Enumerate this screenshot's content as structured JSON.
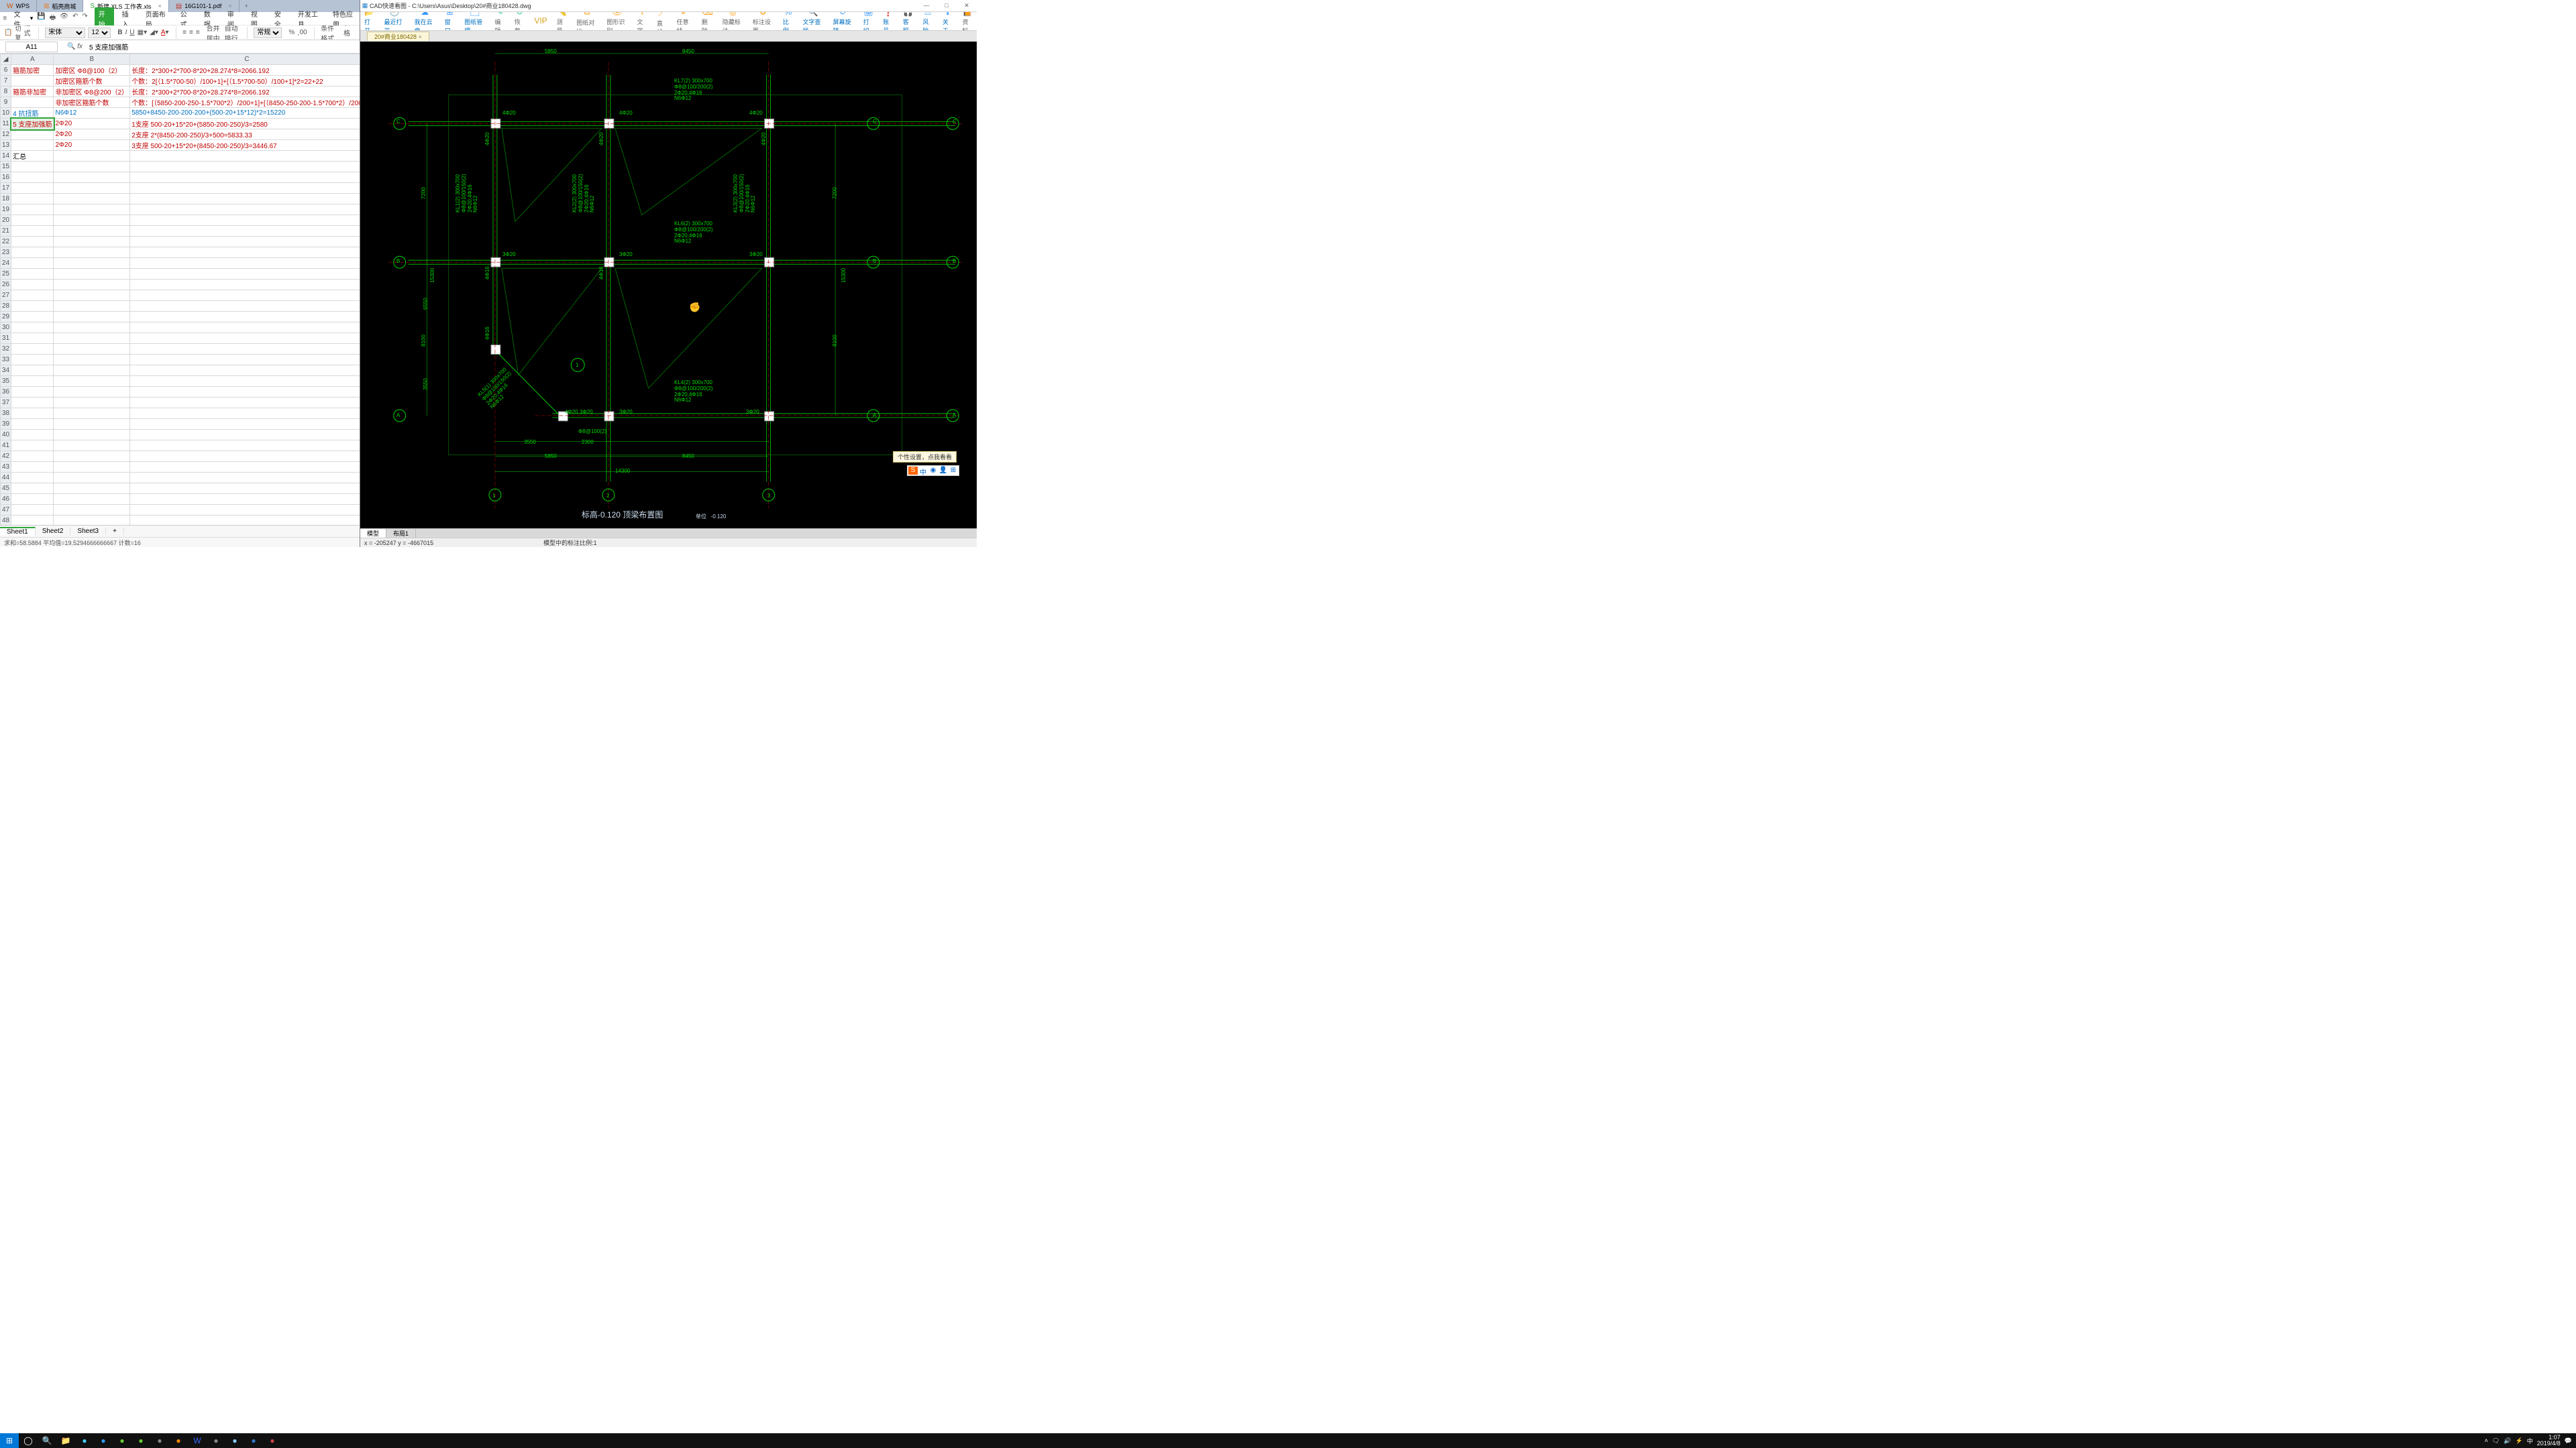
{
  "wps": {
    "tabs": [
      {
        "icon": "W",
        "label": "WPS",
        "iconColor": "#d35400"
      },
      {
        "icon": "⊞",
        "label": "稻壳商城",
        "iconColor": "#e67e22"
      },
      {
        "icon": "S",
        "label": "新建 XLS 工作表.xls",
        "iconColor": "#2fa639",
        "active": true,
        "closeable": true
      },
      {
        "icon": "📄",
        "label": "16G101-1.pdf",
        "iconColor": "#c0392b",
        "closeable": true
      }
    ],
    "menu": {
      "file": "文件",
      "items": [
        "开始",
        "插入",
        "页面布局",
        "公式",
        "数据",
        "审阅",
        "视图",
        "安全",
        "开发工具",
        "特色应用"
      ]
    },
    "toolbar": {
      "cut": "剪切",
      "copy": "复制",
      "paint": "格式刷",
      "font": "宋体",
      "size": "12",
      "style": "常规",
      "merge": "合并居中",
      "wrap": "自动换行",
      "cond": "条件格式",
      "table": "表格样"
    },
    "cell_ref": "A11",
    "fx_val": "5 支座加强筋",
    "cols": [
      "A",
      "B",
      "C"
    ],
    "rows": [
      {
        "n": 6,
        "a": "箍筋加密",
        "b": "加密区   Φ8@100（2）",
        "c": "长度：2*300+2*700-8*20+28.274*8=2066.192",
        "cls": "red"
      },
      {
        "n": 7,
        "a": "",
        "b": "加密区箍筋个数",
        "c": "个数：2[（1.5*700-50）/100+1]+[（1.5*700-50）/100+1]*2=22+22",
        "cls": "red",
        "cBlueTail": true
      },
      {
        "n": 8,
        "a": "箍筋非加密",
        "b": "非加密区 Φ8@200（2）",
        "c": "长度：2*300+2*700-8*20+28.274*8=2066.192",
        "cls": "red"
      },
      {
        "n": 9,
        "a": "",
        "b": "非加密区箍筋个数",
        "c": "个数：[（5850-200-250-1.5*700*2）/200+1]+[（8450-250-200-1.5*700*2）/200",
        "cls": "red"
      },
      {
        "n": 10,
        "a": "4 抗扭筋",
        "b": "N6Φ12",
        "c": "5850+8450-200-200-200+(500-20+15*12)*2=15220",
        "cls": "blue"
      },
      {
        "n": 11,
        "a": "5 支座加强筋",
        "b": "2Φ20",
        "c": "1支座   500-20+15*20+(5850-200-250)/3=2580",
        "cls": "red",
        "sel": true
      },
      {
        "n": 12,
        "a": "",
        "b": "2Φ20",
        "c": "2支座   2*(8450-200-250)/3+500=5833.33",
        "cls": "red"
      },
      {
        "n": 13,
        "a": "",
        "b": "2Φ20",
        "c": "3支座   500-20+15*20+(8450-200-250)/3=3446.67",
        "cls": "red"
      },
      {
        "n": 14,
        "a": "汇总",
        "b": "",
        "c": "",
        "cls": ""
      }
    ],
    "sheets": [
      "Sheet1",
      "Sheet2",
      "Sheet3"
    ],
    "status": "求和=58.5884   平均值=19.5294666666667   计数=16"
  },
  "cad": {
    "title": "CAD快速看图 - C:\\Users\\Asus\\Desktop\\20#商业180428.dwg",
    "ribbon": [
      {
        "ic": "📂",
        "t": "打开",
        "c": "blue"
      },
      {
        "ic": "🕘",
        "t": "最近打开",
        "c": "blue"
      },
      {
        "ic": "☁",
        "t": "我在云盘",
        "c": "blue"
      },
      {
        "ic": "⊞",
        "t": "窗口",
        "c": "blue"
      },
      {
        "ic": "🗂",
        "t": "图纸管理",
        "c": "blue"
      },
      {
        "ic": "✎",
        "t": "编辑",
        "c": ""
      },
      {
        "ic": "↺",
        "t": "恢复",
        "c": ""
      },
      {
        "ic": "VIP",
        "t": "",
        "c": "gold"
      },
      {
        "ic": "📏",
        "t": "测量",
        "c": "orange"
      },
      {
        "ic": "⧉",
        "t": "图纸对比",
        "c": "orange"
      },
      {
        "ic": "👁",
        "t": "图形识别",
        "c": "orange"
      },
      {
        "ic": "T",
        "t": "文字",
        "c": "orange"
      },
      {
        "ic": "／",
        "t": "直线",
        "c": "orange"
      },
      {
        "ic": "✐",
        "t": "任意线",
        "c": "orange"
      },
      {
        "ic": "⌫",
        "t": "删除",
        "c": "orange"
      },
      {
        "ic": "◎",
        "t": "隐藏标注",
        "c": "orange"
      },
      {
        "ic": "⚙",
        "t": "标注设置",
        "c": "orange"
      },
      {
        "ic": "%",
        "t": "比例",
        "c": "blue"
      },
      {
        "ic": "🔍",
        "t": "文字查找",
        "c": "blue"
      },
      {
        "ic": "⟳",
        "t": "屏幕旋转",
        "c": "blue"
      },
      {
        "ic": "🖨",
        "t": "打印",
        "c": "blue"
      },
      {
        "ic": "❓",
        "t": "账号",
        "c": "blue"
      },
      {
        "ic": "🎧",
        "t": "客服",
        "c": "blue"
      },
      {
        "ic": "⚠",
        "t": "风险",
        "c": "blue"
      },
      {
        "ic": "ℹ",
        "t": "关于",
        "c": "blue"
      },
      {
        "ic": "📙",
        "t": "资料",
        "c": "orange"
      }
    ],
    "doc_tab": "20#商业180428",
    "dims": {
      "top1": "5850",
      "top2": "8450",
      "left1": "7200",
      "left2": "8100",
      "left_total": "15300",
      "right1": "7200",
      "right2": "8100",
      "right_total": "15300",
      "bot1": "5850",
      "bot2": "8450",
      "bot_total": "14300",
      "seg_a": "3550",
      "seg_b": "2300",
      "mid_l": "6550",
      "mid_r": "3550",
      "stirrup": "Φ8@100(2)"
    },
    "rebar_lbls": {
      "c_a": "4Φ20",
      "c_b": "4Φ20",
      "c_c": "4Φ20",
      "b_a": "3Φ20",
      "b_b": "3Φ20",
      "b_c": "3Φ20",
      "a_b": "4Φ20 3Φ20",
      "a_c": "3Φ20",
      "a_d": "3Φ20",
      "v1": "4Φ20",
      "v2": "4Φ20",
      "v3": "4Φ20",
      "v4": "4Φ16",
      "v5": "4Φ16",
      "v6": "4Φ16"
    },
    "beam_lbls": {
      "kl1": "KL1(2) 300x700\nΦ8@100/150(2)\n2Φ20;4Φ16\nN6Φ12",
      "kl2": "KL2(2) 300x700\nΦ8@100/150(2)\n2Φ20;4Φ16\nN6Φ12",
      "kl3": "KL3(2) 300x700\nΦ8@100/150(2)\n2Φ20;4Φ16\nN6Φ12",
      "kl4": "KL4(2) 300x700\nΦ8@100/200(2)\n2Φ20;4Φ16\nN6Φ12",
      "kl5": "KL5(1) 300x700\nΦ8@100/150(2)\n2Φ20;4Φ16\nN6Φ12",
      "kl6": "KL6(2) 300x700\nΦ8@100/200(2)\n2Φ20;4Φ16\nN6Φ12",
      "kl7": "KL7(2) 300x700\nΦ8@100/200(2)\n2Φ20;4Φ16\nN6Φ12"
    },
    "axes": {
      "a": "A",
      "b": "B",
      "c": "C",
      "n1": "1",
      "n2": "2",
      "n3": "3"
    },
    "drawing_title": "标高-0.120 顶梁布置图",
    "level_note": "单位   -0.120",
    "section_mark": "1",
    "bot_tabs": [
      "模型",
      "布局1"
    ],
    "coord": "x = -205247  y = -4667015",
    "status_r": "模型中的标注比例:1",
    "tip": "个性设置，点我看看",
    "winmin": "—",
    "winmax": "□",
    "winclose": "✕"
  },
  "task": {
    "buttons": [
      "⊞",
      "◯",
      "🔍",
      "📁",
      "●",
      "●",
      "●",
      "●",
      "●",
      "●",
      "●",
      "W",
      "●",
      "●",
      "●",
      "●",
      "●"
    ],
    "time": "1:07",
    "date": "2019/4/8"
  }
}
